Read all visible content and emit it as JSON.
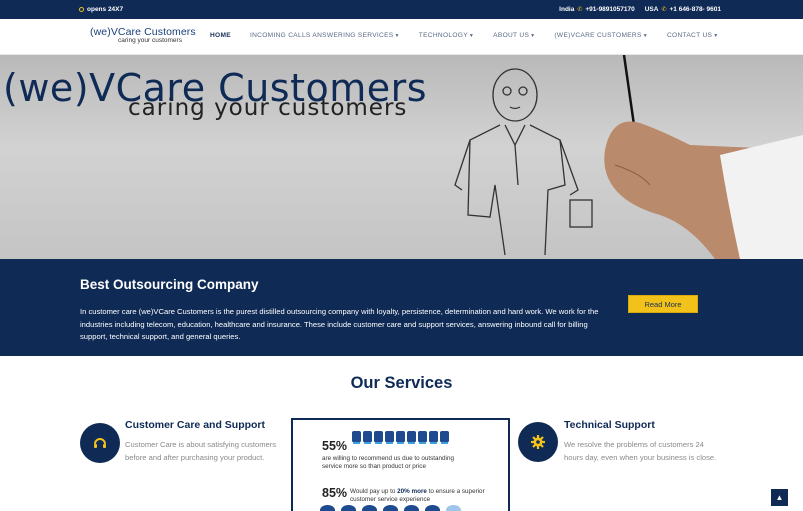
{
  "topbar": {
    "hours": "opens 24X7",
    "india_label": "India",
    "india_phone": "+91-9891057170",
    "usa_label": "USA",
    "usa_phone": "+1 646-878- 9601"
  },
  "logo": {
    "name": "(we)VCare Customers",
    "tagline": "caring your customers"
  },
  "nav": {
    "items": [
      {
        "label": "HOME",
        "dropdown": false
      },
      {
        "label": "INCOMING CALLS ANSWERING SERVICES",
        "dropdown": true
      },
      {
        "label": "TECHNOLOGY",
        "dropdown": true
      },
      {
        "label": "ABOUT US",
        "dropdown": true
      },
      {
        "label": "(WE)VCARE CUSTOMERS",
        "dropdown": true
      },
      {
        "label": "CONTACT US",
        "dropdown": true
      }
    ]
  },
  "hero": {
    "title": "(we)VCare Customers",
    "subtitle": "caring your customers"
  },
  "intro": {
    "heading": "Best Outsourcing Company",
    "body": "In customer care (we)VCare Customers is the purest distilled outsourcing company with loyalty, persistence, determination and hard work. We work for the industries including telecom, education, healthcare and insurance. These include customer care and support services, answering inbound call for billing support, technical support, and general queries.",
    "button": "Read More"
  },
  "services": {
    "title": "Our Services",
    "left": {
      "icon": "headset-icon",
      "heading": "Customer Care and Support",
      "text": "Customer Care is about satisfying customers before and after purchasing your product."
    },
    "right": {
      "icon": "gear-icon",
      "heading": "Technical Support",
      "text": "We resolve the problems of customers 24 hours day, even when your business is close."
    },
    "infographic": {
      "stat1_value": "55%",
      "stat1_text": "are willing to recommend us due to outstanding service more so than product or price",
      "stat2_value": "85%",
      "stat2_text_pre": "Would pay up to ",
      "stat2_text_bold": "20% more",
      "stat2_text_post": " to ensure a superior customer service experience"
    }
  },
  "colors": {
    "navy": "#0e2a55",
    "accent": "#f2c21a"
  },
  "scroll_top_icon": "chevron-up-icon"
}
